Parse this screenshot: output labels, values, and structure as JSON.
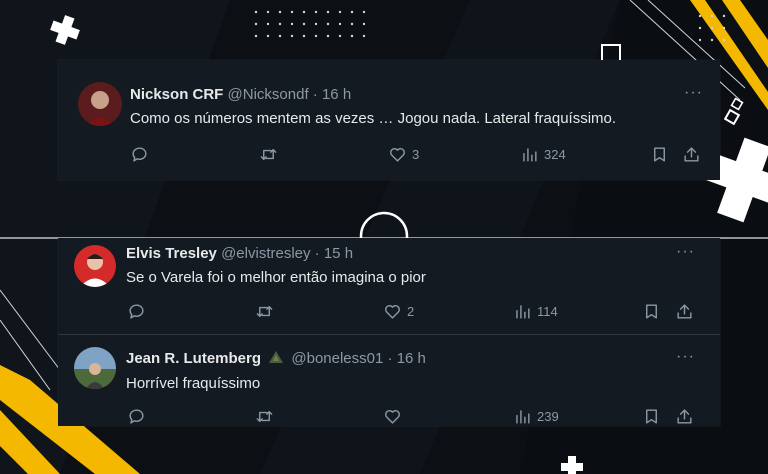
{
  "tweets": [
    {
      "name": "Nickson CRF",
      "handle": "@Nicksondf",
      "separator": "·",
      "time": "16 h",
      "text": "Como os números mentem as vezes … Jogou nada. Lateral fraquíssimo.",
      "likes": "3",
      "views": "324",
      "more": "···"
    },
    {
      "name": "Elvis Tresley",
      "handle": "@elvistresley",
      "separator": "·",
      "time": "15 h",
      "text": "Se o Varela foi o melhor então imagina o pior",
      "likes": "2",
      "views": "114",
      "more": "···"
    },
    {
      "name": "Jean R. Lutemberg",
      "handle": "@boneless01",
      "separator": "·",
      "time": "16 h",
      "text": "Horrível fraquíssimo",
      "likes": "",
      "views": "239",
      "more": "···"
    }
  ],
  "colors": {
    "background": "#0c0f13",
    "card": "#141a22",
    "accent_yellow": "#f5b800",
    "text": "#e7e9ea",
    "muted": "#8b98a5"
  },
  "icons": [
    "reply-icon",
    "retweet-icon",
    "like-icon",
    "views-icon",
    "bookmark-icon",
    "share-icon",
    "more-icon",
    "verified-triangle-icon"
  ]
}
